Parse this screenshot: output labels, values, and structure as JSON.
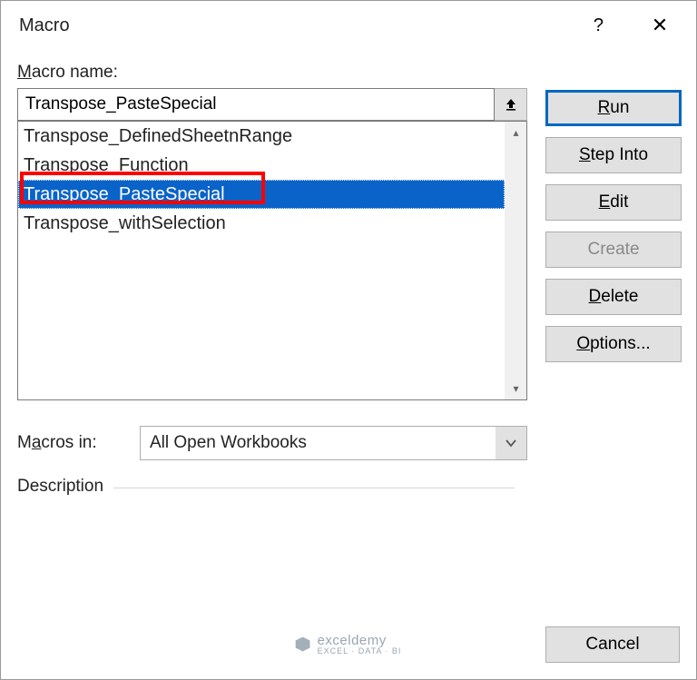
{
  "dialog": {
    "title": "Macro",
    "help_icon": "?",
    "close_icon": "✕"
  },
  "labels": {
    "macro_name": "Macro name:",
    "macros_in": "Macros in:",
    "description": "Description"
  },
  "name_input": {
    "value": "Transpose_PasteSpecial"
  },
  "macro_list": {
    "items": [
      {
        "label": "Transpose_DefinedSheetnRange",
        "selected": false
      },
      {
        "label": "Transpose_Function",
        "selected": false
      },
      {
        "label": "Transpose_PasteSpecial",
        "selected": true
      },
      {
        "label": "Transpose_withSelection",
        "selected": false
      }
    ]
  },
  "macros_in_dropdown": {
    "selected": "All Open Workbooks"
  },
  "buttons": {
    "run": "Run",
    "step_into": "Step Into",
    "edit": "Edit",
    "create": "Create",
    "delete": "Delete",
    "options": "Options...",
    "cancel": "Cancel"
  },
  "watermark": {
    "brand": "exceldemy",
    "tagline": "EXCEL · DATA · BI"
  }
}
